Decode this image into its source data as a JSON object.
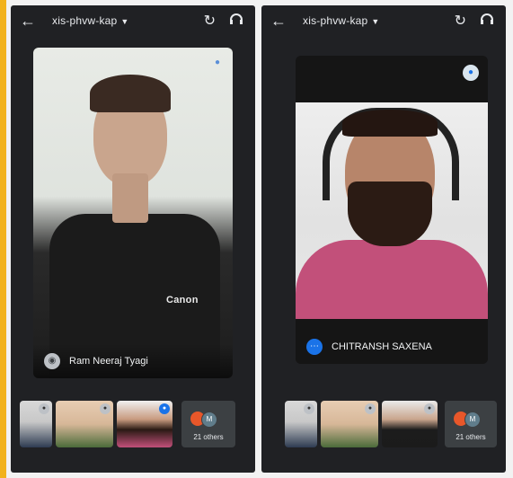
{
  "screens": [
    {
      "meeting_code": "xis-phvw-kap",
      "main_participant": "Ram Neeraj Tyagi",
      "shirt_logo": "Canon",
      "others_label": "21 others",
      "others_avatars": [
        "",
        "M"
      ]
    },
    {
      "meeting_code": "xis-phvw-kap",
      "main_participant": "CHITRANSH SAXENA",
      "others_label": "21 others",
      "others_avatars": [
        "",
        "M"
      ]
    }
  ],
  "icons": {
    "back": "arrow-left-icon",
    "rotate_camera": "rotate-camera-icon",
    "audio": "headphones-icon",
    "mic": "mic-icon"
  },
  "colors": {
    "accent_bar": "#f2b21b",
    "phone_bg": "#202124",
    "name_badge_blue": "#1a73e8",
    "shirt_pink": "#c2507a"
  }
}
